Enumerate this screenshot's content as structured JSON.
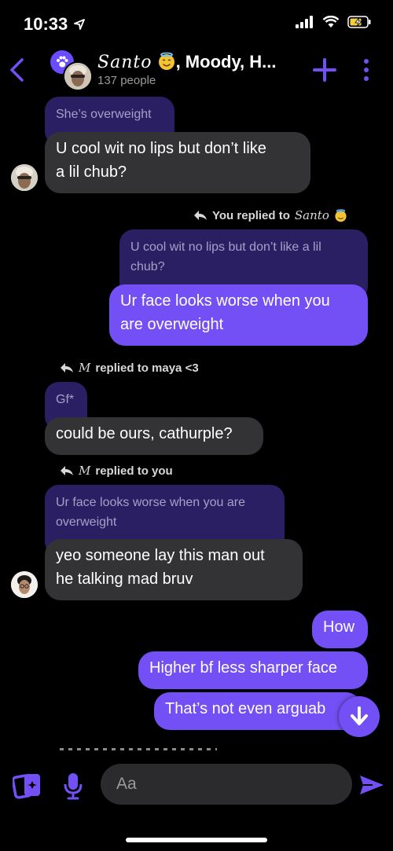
{
  "status_bar": {
    "time": "10:33"
  },
  "header": {
    "title_script": "Santo",
    "title_rest": ", Moody, H...",
    "subtitle": "137 people",
    "accent": "#7350f5"
  },
  "messages": {
    "m1_quote": "She’s overweight",
    "m1_text_line1": "U cool wit no lips but don’t like",
    "m1_text_line2": "a lil chub?",
    "m2_meta_prefix": "You replied to",
    "m2_meta_target": "Santo",
    "m2_quote_line1": "U cool wit no lips but don’t like a lil",
    "m2_quote_line2": "chub?",
    "m2_text_line1": "Ur face looks worse when you",
    "m2_text_line2": "are overweight",
    "m3_meta_sender": "M",
    "m3_meta_rest": "replied to maya <3",
    "m3_quote": "Gf*",
    "m3_text": "could be ours, cathurple?",
    "m4_meta_sender": "M",
    "m4_meta_rest": "replied to you",
    "m4_quote_line1": "Ur face looks worse when you are",
    "m4_quote_line2": "overweight",
    "m4_text_line1": "yeo someone lay this man out",
    "m4_text_line2": "he talking mad bruv",
    "m5_text": "How",
    "m6_text": "Higher bf less sharper face",
    "m7_text": "That’s not even arguab"
  },
  "composer": {
    "placeholder": "Aa"
  }
}
